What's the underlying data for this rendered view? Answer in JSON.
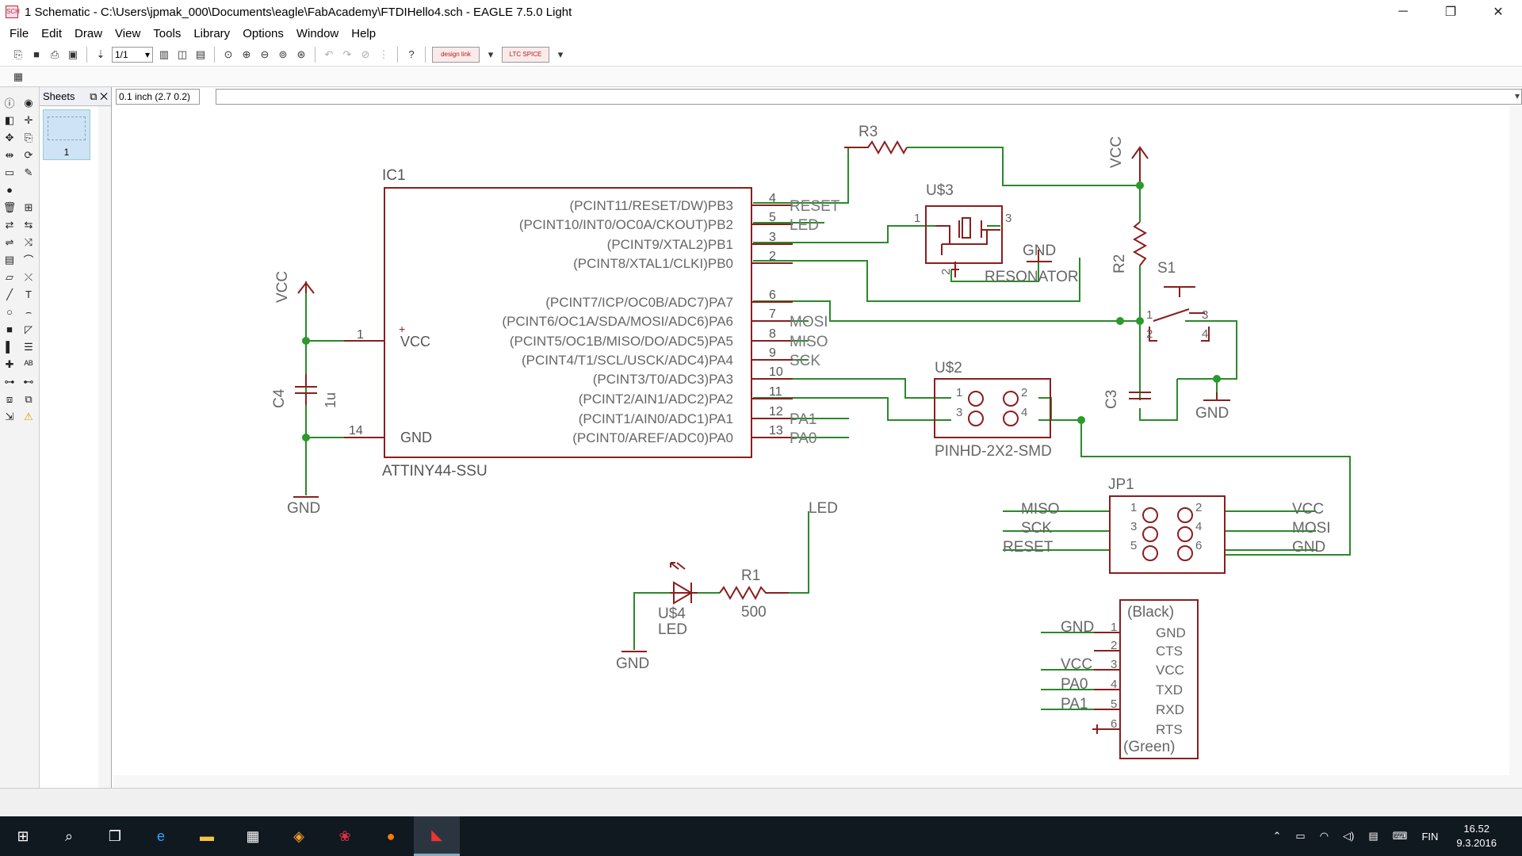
{
  "window": {
    "title": "1 Schematic - C:\\Users\\jpmak_000\\Documents\\eagle\\FabAcademy\\FTDIHello4.sch - EAGLE 7.5.0 Light",
    "app_icon_text": "SCH",
    "minimize": "─",
    "maximize": "❐",
    "close": "✕"
  },
  "menu": [
    "File",
    "Edit",
    "Draw",
    "View",
    "Tools",
    "Library",
    "Options",
    "Window",
    "Help"
  ],
  "toolbar": {
    "sheet_select": "1/1",
    "logo1": "design link",
    "logo2": "LTC SPICE"
  },
  "sheets": {
    "title": "Sheets",
    "sheet_number": "1"
  },
  "coord": "0.1 inch (2.7 0.2)",
  "colors": {
    "part": "#8b1e1e",
    "net": "#2a8a2a",
    "junction": "#2a9a2a"
  },
  "schematic": {
    "ic1": {
      "name": "IC1",
      "value": "ATTINY44-SSU",
      "left_pins": [
        {
          "num": "1",
          "label": "VCC"
        },
        {
          "num": "14",
          "label": "GND"
        }
      ],
      "right_pins": [
        {
          "num": "4",
          "label": "(PCINT11/RESET/DW)PB3",
          "net": "RESET"
        },
        {
          "num": "5",
          "label": "(PCINT10/INT0/OC0A/CKOUT)PB2",
          "net": "LED"
        },
        {
          "num": "3",
          "label": "(PCINT9/XTAL2)PB1",
          "net": ""
        },
        {
          "num": "2",
          "label": "(PCINT8/XTAL1/CLKI)PB0",
          "net": ""
        },
        {
          "num": "6",
          "label": "(PCINT7/ICP/OC0B/ADC7)PA7",
          "net": ""
        },
        {
          "num": "7",
          "label": "(PCINT6/OC1A/SDA/MOSI/ADC6)PA6",
          "net": "MOSI"
        },
        {
          "num": "8",
          "label": "(PCINT5/OC1B/MISO/DO/ADC5)PA5",
          "net": "MISO"
        },
        {
          "num": "9",
          "label": "(PCINT4/T1/SCL/USCK/ADC4)PA4",
          "net": "SCK"
        },
        {
          "num": "10",
          "label": "(PCINT3/T0/ADC3)PA3",
          "net": ""
        },
        {
          "num": "11",
          "label": "(PCINT2/AIN1/ADC2)PA2",
          "net": ""
        },
        {
          "num": "12",
          "label": "(PCINT1/AIN0/ADC1)PA1",
          "net": "PA1"
        },
        {
          "num": "13",
          "label": "(PCINT0/AREF/ADC0)PA0",
          "net": "PA0"
        }
      ]
    },
    "vcc_label": "VCC",
    "gnd_label": "GND",
    "c4": {
      "name": "C4",
      "value": "1u"
    },
    "c3": {
      "name": "C3"
    },
    "r3": {
      "name": "R3"
    },
    "r2": {
      "name": "R2"
    },
    "r1": {
      "name": "R1",
      "value": "500"
    },
    "u3": {
      "name": "U$3",
      "value": "RESONATOR",
      "pin1": "1",
      "pin2": "2",
      "pin3": "3"
    },
    "s1": {
      "name": "S1",
      "p1": "1",
      "p2": "2",
      "p3": "3",
      "p4": "4"
    },
    "u2": {
      "name": "U$2",
      "value": "PINHD-2X2-SMD",
      "pins": [
        "1",
        "2",
        "3",
        "4"
      ]
    },
    "jp1": {
      "name": "JP1",
      "pins": [
        "1",
        "2",
        "3",
        "4",
        "5",
        "6"
      ],
      "left_nets": [
        "MISO",
        "SCK",
        "RESET"
      ],
      "right_nets": [
        "VCC",
        "MOSI",
        "GND"
      ]
    },
    "led_net": "LED",
    "u4": {
      "name": "U$4",
      "value": "LED"
    },
    "ftdi": {
      "top": "(Black)",
      "bottom": "(Green)",
      "pins": [
        "GND",
        "CTS",
        "VCC",
        "TXD",
        "RXD",
        "RTS"
      ],
      "nums": [
        "1",
        "2",
        "3",
        "4",
        "5",
        "6"
      ],
      "nets": [
        "GND",
        "",
        "VCC",
        "PA0",
        "PA1",
        ""
      ]
    }
  },
  "taskbar": {
    "lang": "FIN",
    "time": "16.52",
    "date": "9.3.2016"
  }
}
